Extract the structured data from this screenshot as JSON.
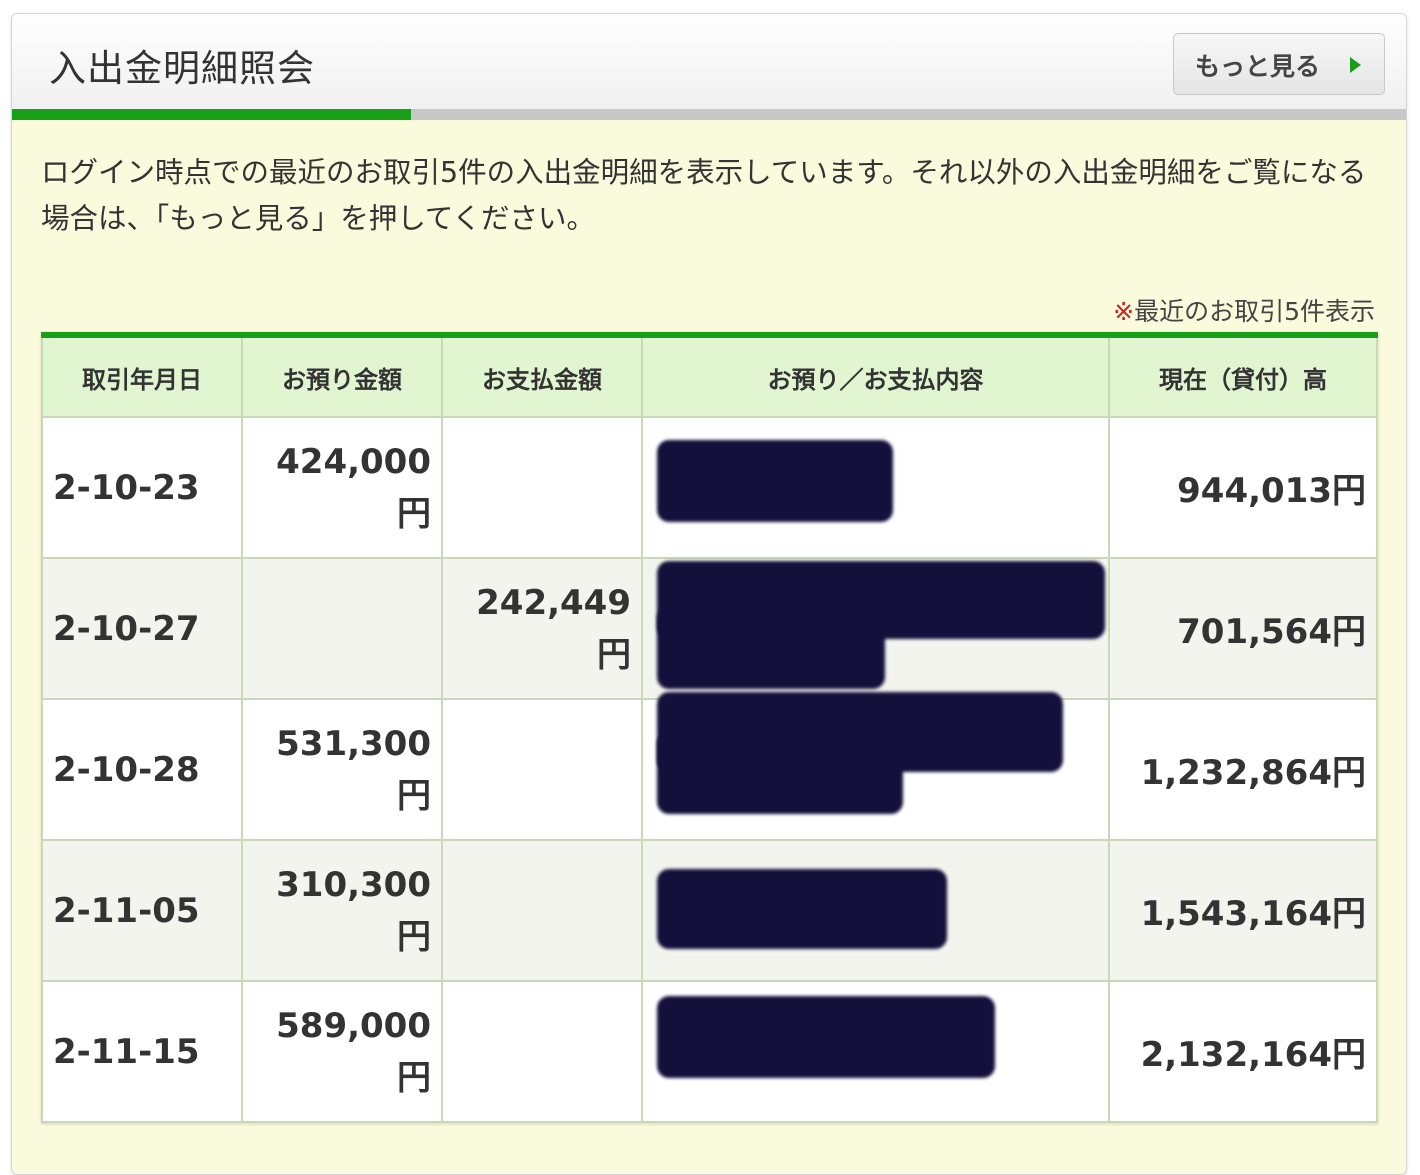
{
  "header": {
    "title": "入出金明細照会",
    "more_button": "もっと見る"
  },
  "description": "ログイン時点での最近のお取引5件の入出金明細を表示しています。それ以外の入出金明細をご覧になる場合は、「もっと見る」を押してください。",
  "note": {
    "mark": "※",
    "text": "最近のお取引5件表示"
  },
  "table": {
    "columns": [
      "取引年月日",
      "お預り金額",
      "お支払金額",
      "お預り／お支払内容",
      "現在（貸付）高"
    ],
    "rows": [
      {
        "date": "2-10-23",
        "deposit": "424,000",
        "deposit_unit": "円",
        "payment": "",
        "payment_unit": "",
        "balance": "944,013円"
      },
      {
        "date": "2-10-27",
        "deposit": "",
        "deposit_unit": "",
        "payment": "242,449",
        "payment_unit": "円",
        "balance": "701,564円"
      },
      {
        "date": "2-10-28",
        "deposit": "531,300",
        "deposit_unit": "円",
        "payment": "",
        "payment_unit": "",
        "balance": "1,232,864円"
      },
      {
        "date": "2-11-05",
        "deposit": "310,300",
        "deposit_unit": "円",
        "payment": "",
        "payment_unit": "",
        "balance": "1,543,164円"
      },
      {
        "date": "2-11-15",
        "deposit": "589,000",
        "deposit_unit": "円",
        "payment": "",
        "payment_unit": "",
        "balance": "2,132,164円"
      }
    ]
  },
  "colors": {
    "accent_green": "#18a018",
    "header_row_bg": "#e1f5d0",
    "panel_bg": "#fafadc",
    "redaction": "#14103c"
  }
}
